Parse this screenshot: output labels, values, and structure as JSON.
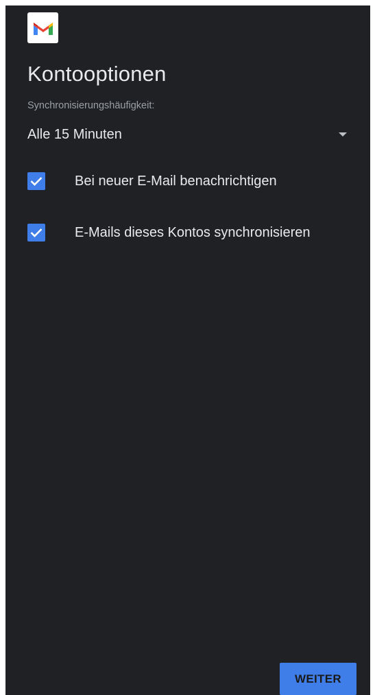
{
  "app": {
    "logo_icon": "gmail-icon"
  },
  "page": {
    "title": "Kontooptionen"
  },
  "sync": {
    "label": "Synchronisierungshäufigkeit:",
    "selected_value": "Alle 15 Minuten"
  },
  "options": [
    {
      "label": "Bei neuer E-Mail benachrichtigen",
      "checked": true
    },
    {
      "label": "E-Mails dieses Kontos synchronisieren",
      "checked": true
    }
  ],
  "actions": {
    "next_label": "WEITER"
  },
  "colors": {
    "background": "#202124",
    "accent": "#3f7ee8",
    "text_primary": "#e8eaed",
    "text_secondary": "#9aa0a6"
  }
}
